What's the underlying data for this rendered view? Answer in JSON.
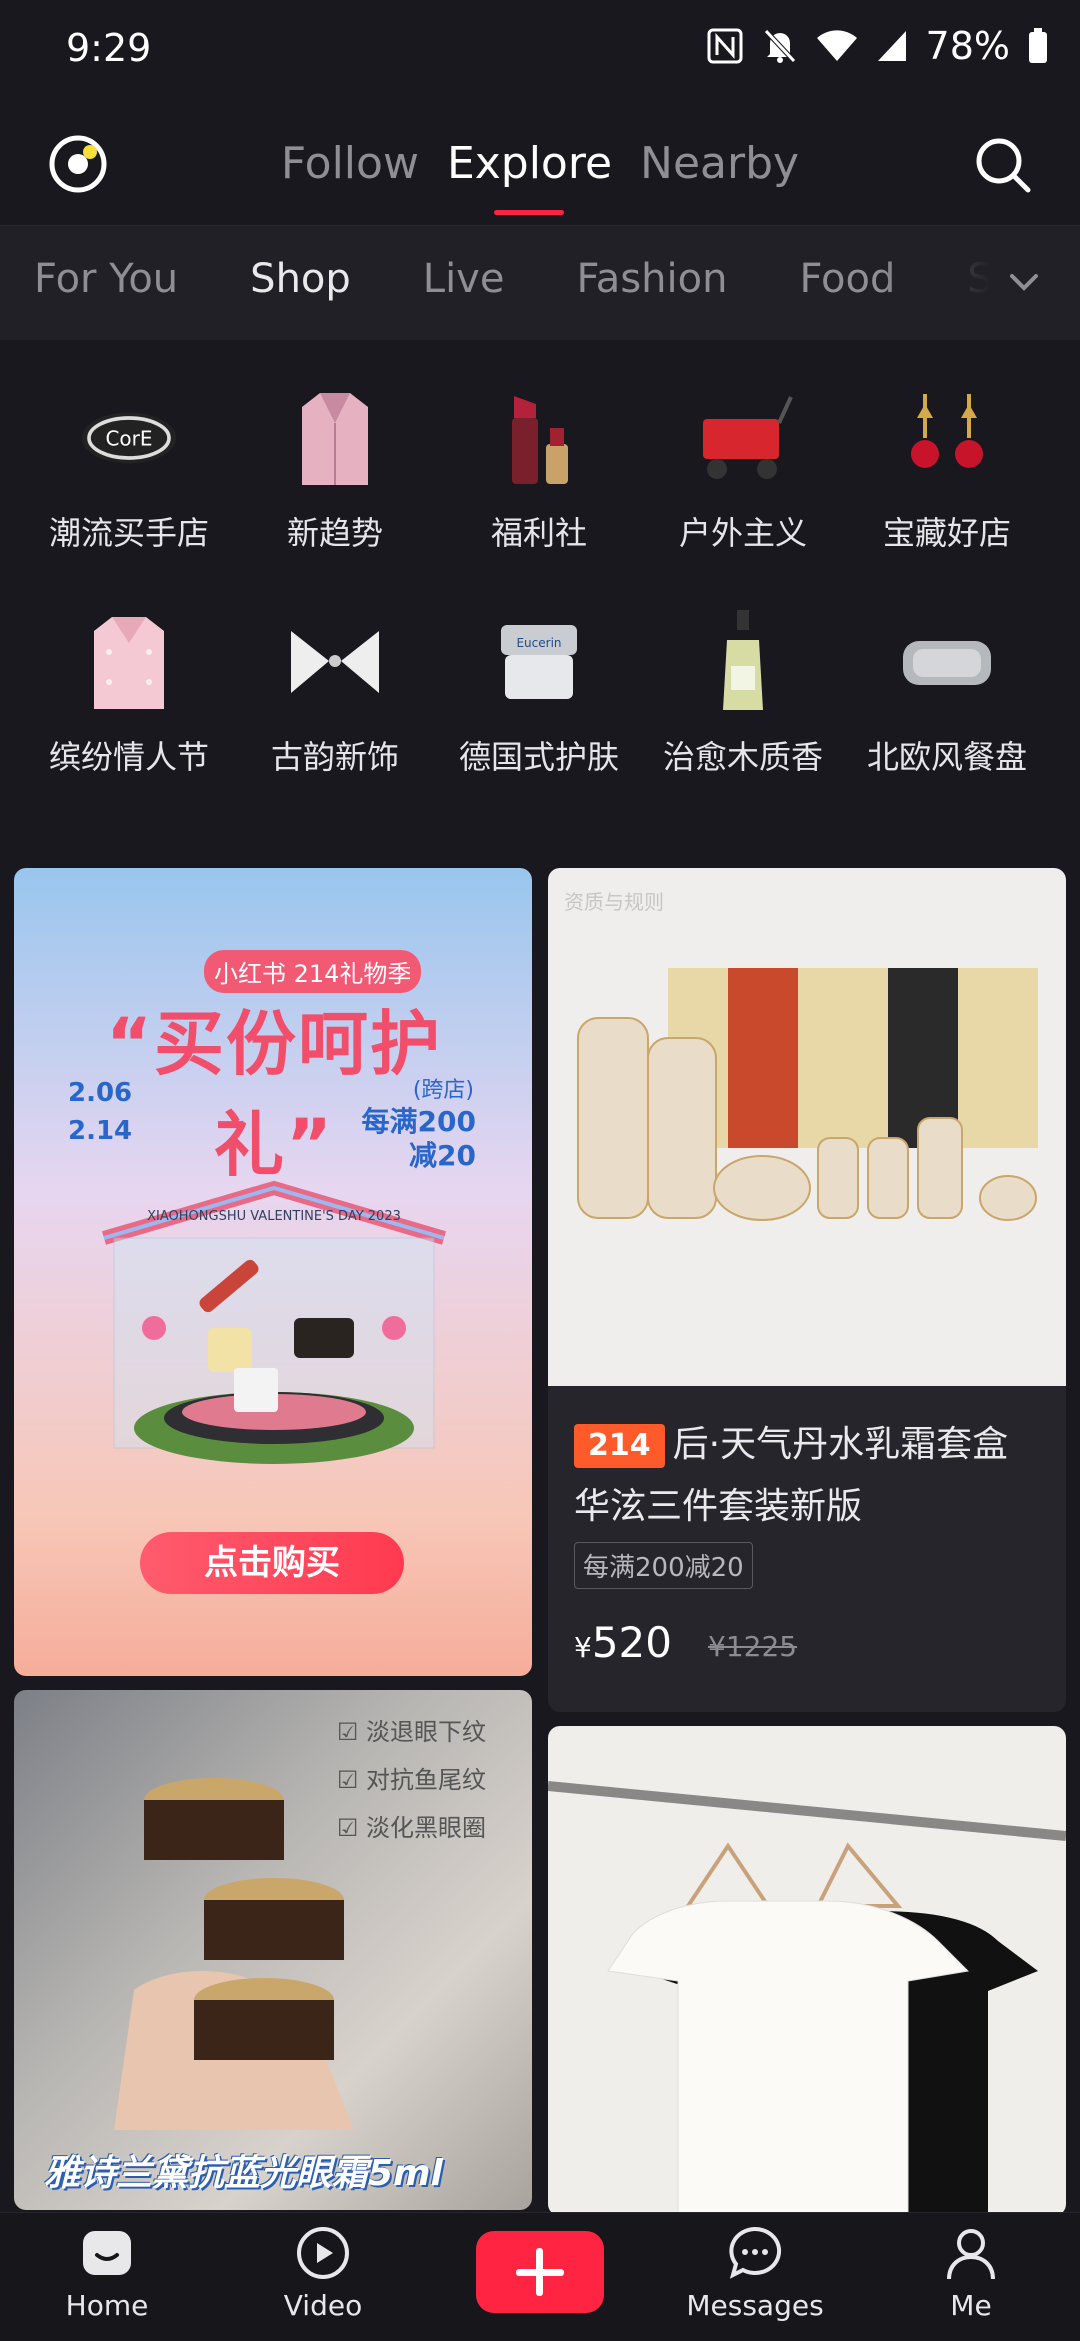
{
  "status_bar": {
    "time": "9:29",
    "battery": "78%",
    "icons": [
      "nfc-icon",
      "bell-off-icon",
      "wifi-icon",
      "signal-icon",
      "battery-icon"
    ]
  },
  "top_nav": {
    "tabs": [
      "Follow",
      "Explore",
      "Nearby"
    ],
    "active_tab": "Explore"
  },
  "categories": {
    "items": [
      "For You",
      "Shop",
      "Live",
      "Fashion",
      "Food",
      "Sk"
    ],
    "active": "Shop"
  },
  "shop_grid": [
    {
      "label": "潮流买手店",
      "icon": "core-logo-icon",
      "logo_text": "CorE"
    },
    {
      "label": "新趋势",
      "icon": "blazer-icon"
    },
    {
      "label": "福利社",
      "icon": "lipstick-icon"
    },
    {
      "label": "户外主义",
      "icon": "wagon-icon"
    },
    {
      "label": "宝藏好店",
      "icon": "earrings-icon"
    },
    {
      "label": "缤纷情人节",
      "icon": "pink-jacket-icon"
    },
    {
      "label": "古韵新饰",
      "icon": "hair-clip-icon"
    },
    {
      "label": "德国式护肤",
      "icon": "cream-jar-icon",
      "brand_text": "Eucerin"
    },
    {
      "label": "治愈木质香",
      "icon": "perfume-icon"
    },
    {
      "label": "北欧风餐盘",
      "icon": "tray-icon"
    }
  ],
  "feed": {
    "promo_card": {
      "badge": "小红书 214礼物季",
      "headline": "“买份呵护礼”",
      "date_start": "2.06",
      "date_end": "2.14",
      "store_tag": "(跨店)",
      "deal_line1": "每满200",
      "deal_line2": "减20",
      "banner": "XIAOHONGSHU VALENTINE'S DAY 2023",
      "cta": "点击购买"
    },
    "product_card": {
      "watermark": "资质与规则",
      "tag": "214",
      "title": "后·天气丹水乳霜套盒华泫三件套装新版",
      "promo": "每满200减20",
      "currency": "¥",
      "price": "520",
      "original_price": "¥1225"
    },
    "eye_cream_card": {
      "checks": [
        "淡退眼下纹",
        "对抗鱼尾纹",
        "淡化黑眼圈"
      ],
      "caption": "雅诗兰黛抗蓝光眼霜5ml"
    }
  },
  "bottom_nav": {
    "items": [
      "Home",
      "Video",
      "Messages",
      "Me"
    ]
  },
  "colors": {
    "accent": "#ff2442",
    "background": "#19181e",
    "tag_orange": "#ff5a2a"
  }
}
